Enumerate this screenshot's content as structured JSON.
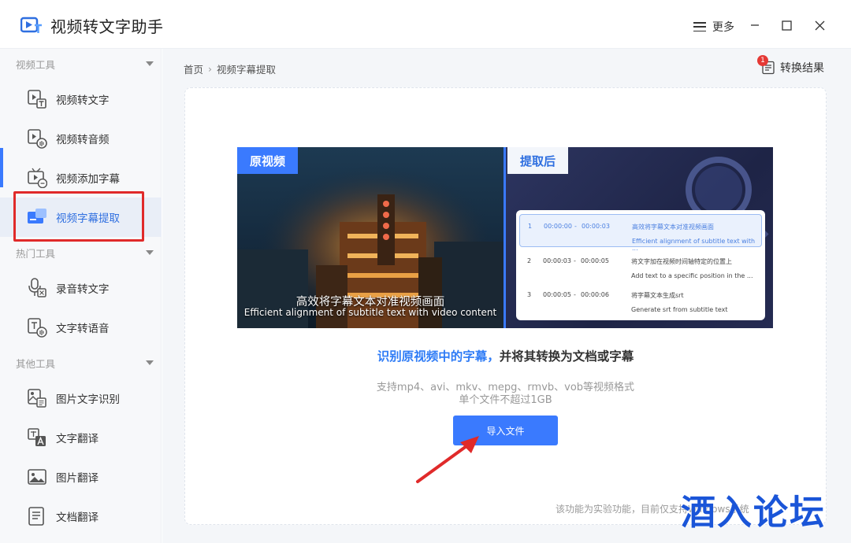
{
  "app": {
    "title": "视频转文字助手",
    "more_label": "更多"
  },
  "sidebar": {
    "groups": [
      {
        "label": "视频工具"
      },
      {
        "label": "热门工具"
      },
      {
        "label": "其他工具"
      }
    ],
    "items": [
      {
        "label": "视频转文字",
        "icon": "video-to-text-icon"
      },
      {
        "label": "视频转音频",
        "icon": "video-to-audio-icon"
      },
      {
        "label": "视频添加字幕",
        "icon": "add-subtitle-icon"
      },
      {
        "label": "视频字幕提取",
        "icon": "subtitle-extract-icon",
        "active": true
      },
      {
        "label": "录音转文字",
        "icon": "mic-icon"
      },
      {
        "label": "文字转语音",
        "icon": "text-to-speech-icon"
      },
      {
        "label": "图片文字识别",
        "icon": "image-ocr-icon"
      },
      {
        "label": "文字翻译",
        "icon": "translate-icon"
      },
      {
        "label": "图片翻译",
        "icon": "image-translate-icon"
      },
      {
        "label": "文档翻译",
        "icon": "document-translate-icon"
      }
    ]
  },
  "header": {
    "breadcrumb": [
      "首页",
      "视频字幕提取"
    ],
    "result_label": "转换结果",
    "result_badge": "1"
  },
  "preview": {
    "left_tag": "原视频",
    "right_tag": "提取后",
    "caption_cn": "高效将字幕文本对准视频画面",
    "caption_en": "Efficient alignment of subtitle text with video content",
    "subtitles": [
      {
        "num": "1",
        "start": "00:00:00",
        "end": "00:00:03",
        "zh": "高效将字幕文本对准视频画面",
        "en": "Efficient alignment of subtitle text with ..."
      },
      {
        "num": "2",
        "start": "00:00:03",
        "end": "00:00:05",
        "zh": "将文字加在视频时间轴特定的位置上",
        "en": "Add text to a specific position in the ..."
      },
      {
        "num": "3",
        "start": "00:00:05",
        "end": "00:00:06",
        "zh": "将字幕文本生成srt",
        "en": "Generate srt from subtitle text"
      }
    ],
    "time_sep": "-"
  },
  "content": {
    "desc_highlight": "识别原视频中的字幕，",
    "desc_rest": "并将其转换为文档或字幕",
    "formats": "支持mp4、avi、mkv、mepg、rmvb、vob等视频格式",
    "size_limit": "单个文件不超过1GB",
    "import_label": "导入文件",
    "footnote": "该功能为实验功能，目前仅支持Windows系统"
  },
  "watermark": "酒入论坛",
  "colors": {
    "accent": "#3a7afe",
    "highlight_text": "#2f7cf6",
    "annotation_red": "#e02a2a"
  }
}
